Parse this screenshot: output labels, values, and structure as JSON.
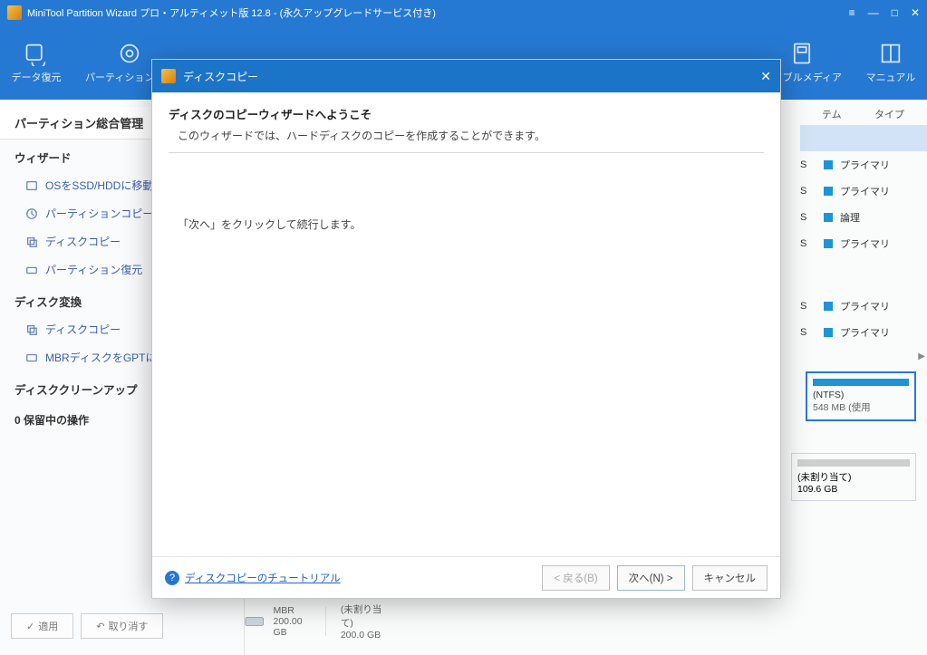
{
  "titlebar": {
    "title": "MiniTool Partition Wizard プロ・アルティメット版 12.8 - (永久アップグレードサービス付き)"
  },
  "toolbar": {
    "items": [
      {
        "label": "データ復元"
      },
      {
        "label": "パーティション復元"
      },
      {
        "label": ""
      },
      {
        "label": ""
      },
      {
        "label": ""
      },
      {
        "label": "ータブルメディア"
      },
      {
        "label": "マニュアル"
      }
    ]
  },
  "sidebar": {
    "tab": "パーティション総合管理",
    "wizard_title": "ウィザード",
    "wizard_items": [
      "OSをSSD/HDDに移動",
      "パーティションコピー",
      "ディスクコピー",
      "パーティション復元"
    ],
    "convert_title": "ディスク変換",
    "convert_items": [
      "ディスクコピー",
      "MBRディスクをGPTに"
    ],
    "cleanup_title": "ディスククリーンアップ",
    "pending": "0 保留中の操作"
  },
  "buttons": {
    "apply": "適用",
    "undo": "取り消す"
  },
  "table": {
    "headers": [
      "テム",
      "タイプ"
    ],
    "rows": [
      {
        "letter": "",
        "type": "",
        "selected": true
      },
      {
        "letter": "S",
        "type": "プライマリ"
      },
      {
        "letter": "S",
        "type": "プライマリ"
      },
      {
        "letter": "S",
        "type": "論理"
      },
      {
        "letter": "S",
        "type": "プライマリ"
      },
      {
        "letter": "",
        "type": ""
      },
      {
        "letter": "",
        "type": ""
      },
      {
        "letter": "S",
        "type": "プライマリ"
      },
      {
        "letter": "S",
        "type": "プライマリ"
      }
    ]
  },
  "disk_cards": {
    "ntfs": {
      "label": "(NTFS)",
      "size": "548 MB (使用"
    },
    "unalloc": {
      "label": "(未割り当て)",
      "size": "109.6 GB"
    }
  },
  "bottom_disk": {
    "type": "MBR",
    "cap": "200.00 GB",
    "state": "(未割り当て)",
    "free": "200.0 GB"
  },
  "dialog": {
    "title": "ディスクコピー",
    "heading": "ディスクのコピーウィザードへようこそ",
    "sub": "このウィザードでは、ハードディスクのコピーを作成することができます。",
    "instruction": "「次へ」をクリックして続行します。",
    "tutorial": "ディスクコピーのチュートリアル",
    "back": "< 戻る(B)",
    "next": "次へ(N) >",
    "cancel": "キャンセル"
  }
}
